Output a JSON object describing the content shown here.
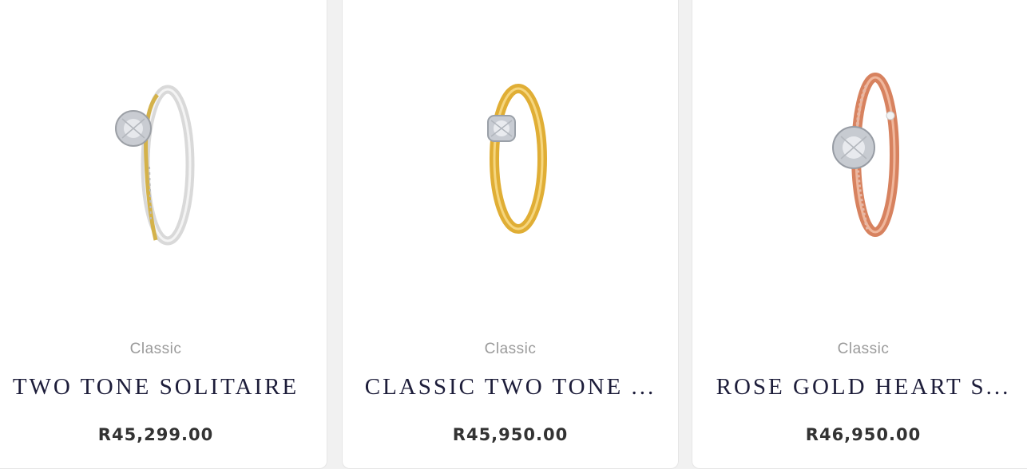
{
  "products": [
    {
      "category": "Classic",
      "name": "TWO TONE SOLITAIRE",
      "price": "R45,299.00",
      "metal": "two-tone-white-yellow",
      "band_color": "#d8d8d8",
      "accent_color": "#d4b24a"
    },
    {
      "category": "Classic",
      "name": "CLASSIC TWO TONE ...",
      "price": "R45,950.00",
      "metal": "yellow-gold",
      "band_color": "#e2b33c",
      "accent_color": "#c9c9c9"
    },
    {
      "category": "Classic",
      "name": "ROSE GOLD HEART S...",
      "price": "R46,950.00",
      "metal": "rose-gold",
      "band_color": "#d9876a",
      "accent_color": "#e8c3b6"
    }
  ],
  "carousel": {
    "prev_icon": "chevron-left-icon"
  }
}
